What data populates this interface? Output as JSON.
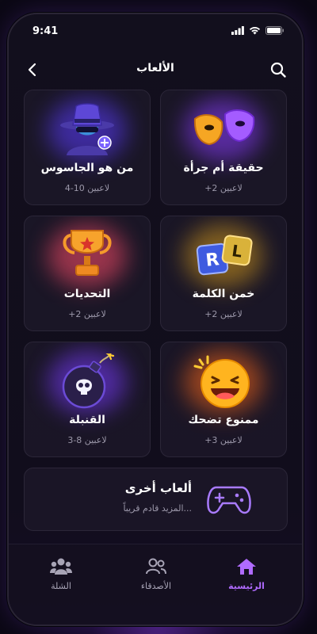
{
  "status": {
    "time": "9:41"
  },
  "header": {
    "title": "الألعاب"
  },
  "games": [
    {
      "name": "حقيقة أم جرأة",
      "players": "+2 لاعبين"
    },
    {
      "name": "من هو الجاسوس",
      "players": "4-10 لاعبين"
    },
    {
      "name": "خمن الكلمة",
      "players": "+2 لاعبين"
    },
    {
      "name": "التحديات",
      "players": "+2 لاعبين"
    },
    {
      "name": "ممنوع تضحك",
      "players": "+3 لاعبين"
    },
    {
      "name": "القنبلة",
      "players": "3-8 لاعبين"
    }
  ],
  "tile_letters": {
    "left": "R",
    "right": "L"
  },
  "more": {
    "title": "ألعاب أخرى",
    "subtitle": "المزيد قادم قريباً..."
  },
  "tabs": [
    {
      "label": "الرئيسية",
      "icon": "home-icon",
      "active": true
    },
    {
      "label": "الأصدقاء",
      "icon": "friends-icon",
      "active": false
    },
    {
      "label": "الشلة",
      "icon": "group-icon",
      "active": false
    }
  ],
  "colors": {
    "accent": "#b06bff",
    "background": "#110d1c",
    "card": "#1c1828"
  }
}
